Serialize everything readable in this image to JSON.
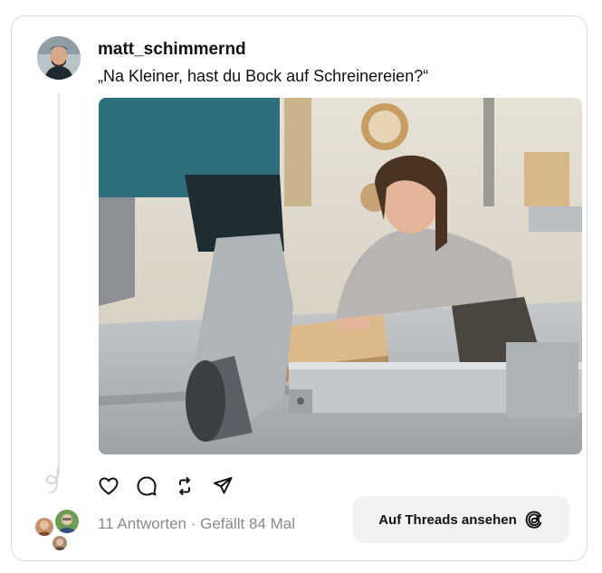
{
  "post": {
    "username": "matt_schimmernd",
    "text": "„Na Kleiner, hast du Bock auf Schreinereien?“"
  },
  "icons": {
    "like": "heart-icon",
    "reply": "speech-bubble-icon",
    "repost": "repost-arrows-icon",
    "share": "paper-plane-icon",
    "threads": "threads-logo-icon"
  },
  "footer": {
    "replies": "11 Antworten",
    "separator": " · ",
    "likes": "Gefällt 84 Mal",
    "open_button": "Auf Threads ansehen"
  }
}
